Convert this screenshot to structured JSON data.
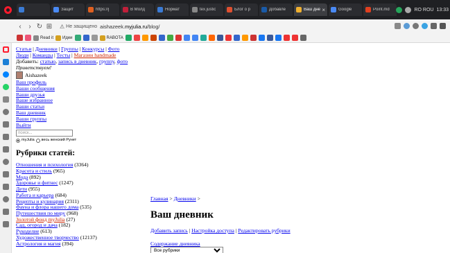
{
  "browser": {
    "tabs": [
      {
        "label": "",
        "color": "#3a7bd5"
      },
      {
        "label": "Защит",
        "color": "#4a8af4"
      },
      {
        "label": "https://j",
        "color": "#e06020"
      },
      {
        "label": "В Молд",
        "color": "#c0203a"
      },
      {
        "label": "Нормат",
        "color": "#3a7bd5"
      },
      {
        "label": "tex.justic",
        "color": "#888888"
      },
      {
        "label": "Блог о р",
        "color": "#e05030"
      },
      {
        "label": "Добавле",
        "color": "#1a5ba8"
      },
      {
        "label": "Ваш днев",
        "color": "#f0b030",
        "active": true
      },
      {
        "label": "Google",
        "color": "#4a8af4"
      },
      {
        "label": "Point.md",
        "color": "#e04020"
      }
    ],
    "tray_text": "RO ROU",
    "clock": "13:33",
    "address": {
      "secure_label": "Не защищено",
      "url_prefix": "aishazeek.",
      "url_domain": "myjulia.ru",
      "url_path": "/blog/"
    },
    "bookmarks": [
      "Read it",
      "Идеи",
      "RABOTA"
    ]
  },
  "nav": {
    "row1": [
      "Статьи",
      "Дневники",
      "Группы",
      "Конкурсы",
      "Фото"
    ],
    "row2": [
      "Люди",
      "Команды",
      "Тесты"
    ],
    "row2_red": "Магазин handmade",
    "add_prefix": "Добавить:",
    "add_links": [
      "статью",
      "запись в дневник",
      "группу",
      "фото"
    ],
    "greeting": "Приветствуем!",
    "username": "Aishazeek",
    "menu": [
      "Ваш профиль",
      "Ваши сообщения",
      "Ваши друзья",
      "Ваше избранное",
      "Ваши статьи",
      "Ваш дневник",
      "Ваши группы",
      "Выйти"
    ]
  },
  "search": {
    "placeholder": "поиск...",
    "radio1": "myJulia",
    "radio2": "весь женский Рунет"
  },
  "rubrics": {
    "title": "Рубрики статей:",
    "items": [
      {
        "name": "Отношения и психология",
        "count": "(3364)"
      },
      {
        "name": "Красота и стиль",
        "count": "(965)"
      },
      {
        "name": "Мода",
        "count": "(892)"
      },
      {
        "name": "Здоровье и фитнес",
        "count": "(1247)"
      },
      {
        "name": "Дети",
        "count": "(955)"
      },
      {
        "name": "Работа и карьера",
        "count": "(684)"
      },
      {
        "name": "Рецепты и кулинария",
        "count": "(2311)"
      },
      {
        "name": "Фауна и флора нашего дома",
        "count": "(535)"
      },
      {
        "name": "Путешествия по миру",
        "count": "(968)"
      },
      {
        "name": "Золотой фонд myJulia",
        "count": "(27)",
        "red": true
      },
      {
        "name": "Сад, огород и дача",
        "count": "(182)"
      },
      {
        "name": "Рукоделие",
        "count": "(613)"
      },
      {
        "name": "Художественное творчество",
        "count": "(12137)"
      },
      {
        "name": "Астрология и магия",
        "count": "(394)"
      }
    ]
  },
  "diary": {
    "breadcrumb_home": "Главная",
    "breadcrumb_sep": ">",
    "breadcrumb_diaries": "Дневники",
    "title": "Ваш дневник",
    "actions": [
      "Добавить запись",
      "Настройка доступа",
      "Редактировать рубрики"
    ],
    "contents_link": "Содержание дневника",
    "select_value": "Все рубрики"
  }
}
